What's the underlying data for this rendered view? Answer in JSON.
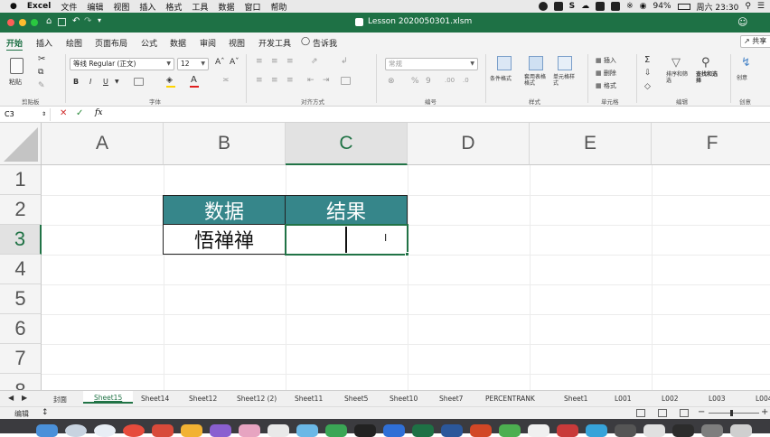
{
  "menubar": {
    "app": "Excel",
    "items": [
      "文件",
      "编辑",
      "视图",
      "插入",
      "格式",
      "工具",
      "数据",
      "窗口",
      "帮助"
    ],
    "battery": "94%",
    "clock": "周六 23:30"
  },
  "window": {
    "title": "Lesson 2020050301.xlsm"
  },
  "ribbon": {
    "tabs": [
      "开始",
      "插入",
      "绘图",
      "页面布局",
      "公式",
      "数据",
      "审阅",
      "视图",
      "开发工具"
    ],
    "tell_me": "告诉我",
    "share": "共享",
    "font_name": "等线 Regular (正文)",
    "font_size": "12",
    "number_format": "常规",
    "paste_label": "粘贴",
    "cond_format": "条件格式",
    "table_format": "套用表格格式",
    "cell_style": "单元格样式",
    "insert": "插入",
    "delete": "删除",
    "format": "格式",
    "sort_filter": "排序和筛选",
    "find_select": "查找和选择",
    "create": "创意",
    "groups": {
      "clipboard": "剪贴板",
      "font": "字体",
      "align": "对齐方式",
      "number": "编号",
      "styles": "样式",
      "cells": "单元格",
      "edit": "编辑",
      "ideas": "创意"
    }
  },
  "formula_bar": {
    "name_box": "C3",
    "value": ""
  },
  "grid": {
    "columns": [
      "A",
      "B",
      "C",
      "D",
      "E",
      "F"
    ],
    "rows": [
      "1",
      "2",
      "3",
      "4",
      "5",
      "6",
      "7",
      "8"
    ],
    "header_fill": "#36868a",
    "cells": {
      "B2": "数据",
      "C2": "结果",
      "B3": "悟禅禅",
      "C3": ""
    }
  },
  "sheet_tabs": [
    "封面",
    "Sheet15",
    "Sheet14",
    "Sheet12",
    "Sheet12 (2)",
    "Sheet11",
    "Sheet5",
    "Sheet10",
    "Sheet7",
    "PERCENTRANK",
    "Sheet1",
    "L001",
    "L002",
    "L003"
  ],
  "active_sheet": "Sheet15",
  "status": {
    "mode": "编辑"
  },
  "colors": {
    "excel_green": "#1e7145",
    "selection": "#217346"
  }
}
